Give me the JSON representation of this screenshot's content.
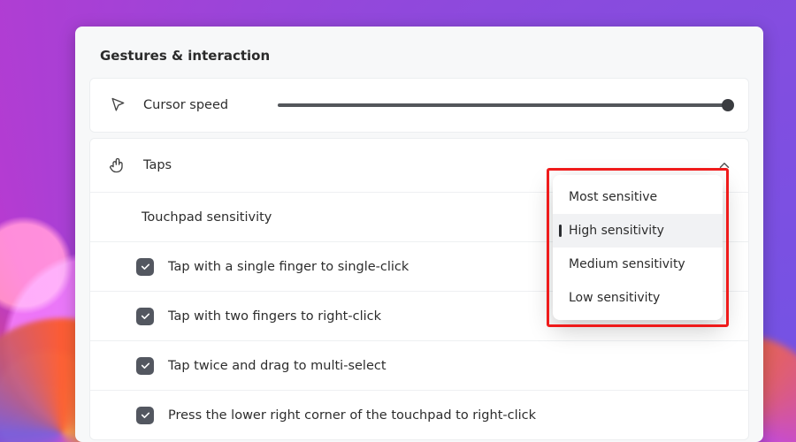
{
  "section": {
    "title": "Gestures & interaction"
  },
  "cursor": {
    "label": "Cursor speed"
  },
  "taps": {
    "label": "Taps",
    "sensitivity_label": "Touchpad sensitivity",
    "options": [
      {
        "label": "Tap with a single finger to single-click",
        "checked": true
      },
      {
        "label": "Tap with two fingers to right-click",
        "checked": true
      },
      {
        "label": "Tap twice and drag to multi-select",
        "checked": true
      },
      {
        "label": "Press the lower right corner of the touchpad to right-click",
        "checked": true
      }
    ]
  },
  "dropdown": {
    "items": [
      {
        "label": "Most sensitive",
        "selected": false
      },
      {
        "label": "High sensitivity",
        "selected": true
      },
      {
        "label": "Medium sensitivity",
        "selected": false
      },
      {
        "label": "Low sensitivity",
        "selected": false
      }
    ]
  }
}
